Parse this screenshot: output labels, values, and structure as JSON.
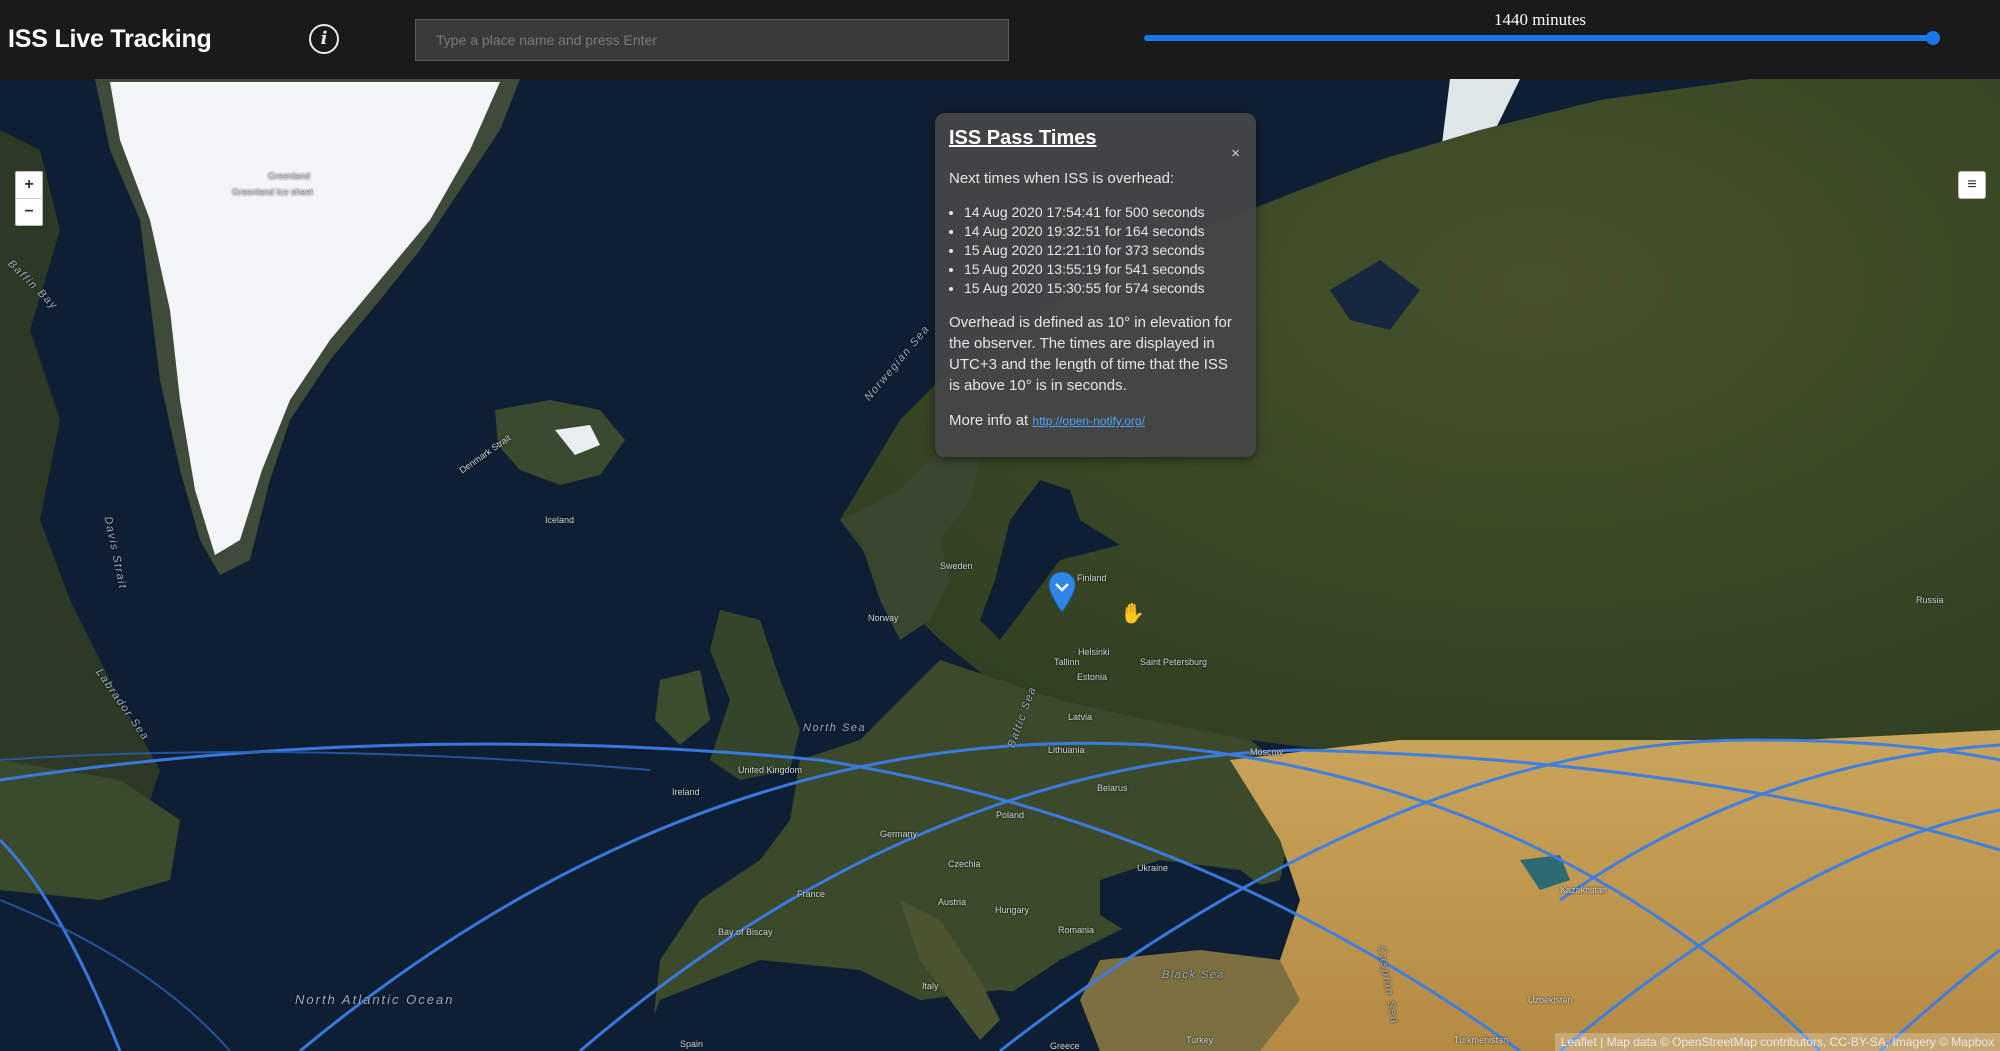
{
  "header": {
    "title": "ISS Live Tracking",
    "info_icon": "info-icon",
    "search_placeholder": "Type a place name and press Enter",
    "minutes_label": "1440 minutes",
    "slider_value": 1.0
  },
  "map": {
    "zoom_in": "+",
    "zoom_out": "−",
    "layers_icon": "layers-icon",
    "attribution": "Leaflet | Map data © OpenStreetMap contributors, CC-BY-SA, Imagery © Mapbox",
    "labels": {
      "greenland": "Greenland",
      "greenland_ice": "Greenland Ice sheet",
      "baffin_bay": "Baffin Bay",
      "davis_strait": "Davis Strait",
      "labrador_sea": "Labrador Sea",
      "denmark_strait": "Denmark Strait",
      "norwegian_sea": "Norwegian Sea",
      "north_sea": "North Sea",
      "baltic_sea": "Baltic Sea",
      "black_sea": "Black Sea",
      "caspian_sea": "Caspian Sea",
      "north_atlantic": "North Atlantic Ocean",
      "bay_of_biscay": "Bay of Biscay",
      "iceland": "Iceland",
      "finland": "Finland",
      "norway": "Norway",
      "sweden": "Sweden",
      "united_kingdom": "United Kingdom",
      "ireland": "Ireland",
      "france": "France",
      "spain": "Spain",
      "italy": "Italy",
      "germany": "Germany",
      "poland": "Poland",
      "ukraine": "Ukraine",
      "belarus": "Belarus",
      "romania": "Romania",
      "hungary": "Hungary",
      "greece": "Greece",
      "turkey": "Turkey",
      "russia": "Russia",
      "kazakhstan": "Kazakhstan",
      "uzbekistan": "Uzbekistan",
      "turkmenistan": "Turkmenistan",
      "estonia": "Estonia",
      "latvia": "Latvia",
      "lithuania": "Lithuania",
      "austria": "Austria",
      "czechia": "Czechia",
      "moscow": "Moscow",
      "st_petersburg": "Saint Petersburg",
      "helsinki": "Helsinki",
      "tallinn": "Tallinn"
    }
  },
  "popup": {
    "title": "ISS Pass Times",
    "close": "×",
    "intro": "Next times when ISS is overhead:",
    "passes": [
      "14 Aug 2020 17:54:41 for 500 seconds",
      "14 Aug 2020 19:32:51 for 164 seconds",
      "15 Aug 2020 12:21:10 for 373 seconds",
      "15 Aug 2020 13:55:19 for 541 seconds",
      "15 Aug 2020 15:30:55 for 574 seconds"
    ],
    "note": "Overhead is defined as 10° in elevation for the observer. The times are displayed in UTC+3 and the length of time that the ISS is above 10° is in seconds.",
    "more_info_prefix": "More info at",
    "more_info_link": "http://open-notify.org/"
  },
  "colors": {
    "header_bg": "#1a1a1a",
    "accent": "#1a78e6",
    "track": "#3b7de8",
    "ocean": "#0f1f33"
  }
}
